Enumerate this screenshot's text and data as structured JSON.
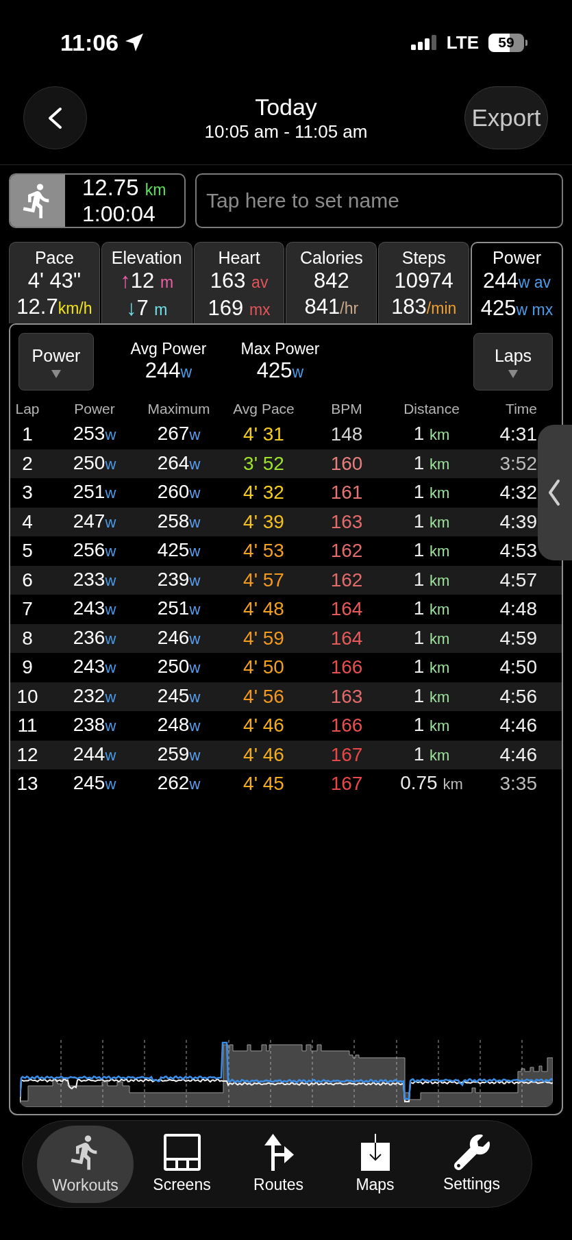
{
  "status_bar": {
    "time": "11:06",
    "network": "LTE",
    "battery": "59"
  },
  "header": {
    "title": "Today",
    "subtitle": "10:05 am - 11:05 am",
    "export_button": "Export"
  },
  "workout": {
    "distance": "12.75",
    "distance_unit": "km",
    "duration": "1:00:04"
  },
  "name_field": {
    "placeholder": "Tap here to set name"
  },
  "metric_tabs": [
    {
      "label": "Pace",
      "selected": false,
      "lines": [
        {
          "value": "4' 43\""
        },
        {
          "value": "12.7",
          "unit": "km/h",
          "color": "#f2e21a",
          "spaced": false
        }
      ]
    },
    {
      "label": "Elevation",
      "selected": false,
      "lines": [
        {
          "prefix": "↑",
          "value": "12",
          "unit": "m",
          "color": "#ec5fa8",
          "spaced": true
        },
        {
          "prefix": "↓",
          "value": "7",
          "unit": "m",
          "color": "#6fe0e8",
          "spaced": true
        }
      ]
    },
    {
      "label": "Heart",
      "selected": false,
      "lines": [
        {
          "value": "163",
          "unit": "av",
          "color": "#e0545a",
          "spaced": true
        },
        {
          "value": "169",
          "unit": "mx",
          "color": "#e0545a",
          "spaced": true
        }
      ]
    },
    {
      "label": "Calories",
      "selected": false,
      "lines": [
        {
          "value": "842"
        },
        {
          "value": "841",
          "unit": "/hr",
          "color": "#c9a88c",
          "spaced": false
        }
      ]
    },
    {
      "label": "Steps",
      "selected": false,
      "lines": [
        {
          "value": "10974"
        },
        {
          "value": "183",
          "unit": "/min",
          "color": "#f0a030",
          "spaced": false
        }
      ]
    },
    {
      "label": "Power",
      "selected": true,
      "lines": [
        {
          "value": "244",
          "unit": "w av",
          "color": "#4b9be8",
          "spaced": false
        },
        {
          "value": "425",
          "unit": "w mx",
          "color": "#4b9be8",
          "spaced": false
        }
      ]
    }
  ],
  "panel": {
    "metric_dropdown": "Power",
    "stats": [
      {
        "label": "Avg Power",
        "value": "244",
        "unit": "w"
      },
      {
        "label": "Max Power",
        "value": "425",
        "unit": "w"
      }
    ],
    "view_dropdown": "Laps"
  },
  "table": {
    "columns": [
      "Lap",
      "Power",
      "Maximum",
      "Avg Pace",
      "BPM",
      "Distance",
      "Time"
    ],
    "rows": [
      {
        "lap": "1",
        "power": {
          "value": "253",
          "unit": "w"
        },
        "maximum": {
          "value": "267",
          "unit": "w"
        },
        "avg_pace": {
          "text": "4' 31",
          "color": "#f5cc1f"
        },
        "bpm": {
          "text": "148",
          "color": "#d4d4d4"
        },
        "distance": {
          "value": "1",
          "unit": "km",
          "color": "#9ee39e"
        },
        "time": {
          "text": "4:31",
          "color": "#f0f0f0"
        }
      },
      {
        "lap": "2",
        "power": {
          "value": "250",
          "unit": "w"
        },
        "maximum": {
          "value": "264",
          "unit": "w"
        },
        "avg_pace": {
          "text": "3' 52",
          "color": "#9ee22e"
        },
        "bpm": {
          "text": "160",
          "color": "#e87f7f"
        },
        "distance": {
          "value": "1",
          "unit": "km",
          "color": "#9ee39e"
        },
        "time": {
          "text": "3:52",
          "color": "#bdbdbd"
        }
      },
      {
        "lap": "3",
        "power": {
          "value": "251",
          "unit": "w"
        },
        "maximum": {
          "value": "260",
          "unit": "w"
        },
        "avg_pace": {
          "text": "4' 32",
          "color": "#f5cc1f"
        },
        "bpm": {
          "text": "161",
          "color": "#e57474"
        },
        "distance": {
          "value": "1",
          "unit": "km",
          "color": "#9ee39e"
        },
        "time": {
          "text": "4:32",
          "color": "#f0f0f0"
        }
      },
      {
        "lap": "4",
        "power": {
          "value": "247",
          "unit": "w"
        },
        "maximum": {
          "value": "258",
          "unit": "w"
        },
        "avg_pace": {
          "text": "4' 39",
          "color": "#f5c01f"
        },
        "bpm": {
          "text": "163",
          "color": "#e36b6b"
        },
        "distance": {
          "value": "1",
          "unit": "km",
          "color": "#9ee39e"
        },
        "time": {
          "text": "4:39",
          "color": "#f0f0f0"
        }
      },
      {
        "lap": "5",
        "power": {
          "value": "256",
          "unit": "w"
        },
        "maximum": {
          "value": "425",
          "unit": "w"
        },
        "avg_pace": {
          "text": "4' 53",
          "color": "#f2a01f"
        },
        "bpm": {
          "text": "162",
          "color": "#e36b6b"
        },
        "distance": {
          "value": "1",
          "unit": "km",
          "color": "#9ee39e"
        },
        "time": {
          "text": "4:53",
          "color": "#f0f0f0"
        }
      },
      {
        "lap": "6",
        "power": {
          "value": "233",
          "unit": "w"
        },
        "maximum": {
          "value": "239",
          "unit": "w"
        },
        "avg_pace": {
          "text": "4' 57",
          "color": "#f29a1f"
        },
        "bpm": {
          "text": "162",
          "color": "#e36b6b"
        },
        "distance": {
          "value": "1",
          "unit": "km",
          "color": "#9ee39e"
        },
        "time": {
          "text": "4:57",
          "color": "#f0f0f0"
        }
      },
      {
        "lap": "7",
        "power": {
          "value": "243",
          "unit": "w"
        },
        "maximum": {
          "value": "251",
          "unit": "w"
        },
        "avg_pace": {
          "text": "4' 48",
          "color": "#f2a01f"
        },
        "bpm": {
          "text": "164",
          "color": "#e65a5a"
        },
        "distance": {
          "value": "1",
          "unit": "km",
          "color": "#9ee39e"
        },
        "time": {
          "text": "4:48",
          "color": "#f0f0f0"
        }
      },
      {
        "lap": "8",
        "power": {
          "value": "236",
          "unit": "w"
        },
        "maximum": {
          "value": "246",
          "unit": "w"
        },
        "avg_pace": {
          "text": "4' 59",
          "color": "#f29a1f"
        },
        "bpm": {
          "text": "164",
          "color": "#e65a5a"
        },
        "distance": {
          "value": "1",
          "unit": "km",
          "color": "#9ee39e"
        },
        "time": {
          "text": "4:59",
          "color": "#f0f0f0"
        }
      },
      {
        "lap": "9",
        "power": {
          "value": "243",
          "unit": "w"
        },
        "maximum": {
          "value": "250",
          "unit": "w"
        },
        "avg_pace": {
          "text": "4' 50",
          "color": "#f2a01f"
        },
        "bpm": {
          "text": "166",
          "color": "#e84f4f"
        },
        "distance": {
          "value": "1",
          "unit": "km",
          "color": "#9ee39e"
        },
        "time": {
          "text": "4:50",
          "color": "#f0f0f0"
        }
      },
      {
        "lap": "10",
        "power": {
          "value": "232",
          "unit": "w"
        },
        "maximum": {
          "value": "245",
          "unit": "w"
        },
        "avg_pace": {
          "text": "4' 56",
          "color": "#f29a1f"
        },
        "bpm": {
          "text": "163",
          "color": "#e36b6b"
        },
        "distance": {
          "value": "1",
          "unit": "km",
          "color": "#9ee39e"
        },
        "time": {
          "text": "4:56",
          "color": "#f0f0f0"
        }
      },
      {
        "lap": "11",
        "power": {
          "value": "238",
          "unit": "w"
        },
        "maximum": {
          "value": "248",
          "unit": "w"
        },
        "avg_pace": {
          "text": "4' 46",
          "color": "#f4ac1f"
        },
        "bpm": {
          "text": "166",
          "color": "#e84f4f"
        },
        "distance": {
          "value": "1",
          "unit": "km",
          "color": "#9ee39e"
        },
        "time": {
          "text": "4:46",
          "color": "#f0f0f0"
        }
      },
      {
        "lap": "12",
        "power": {
          "value": "244",
          "unit": "w"
        },
        "maximum": {
          "value": "259",
          "unit": "w"
        },
        "avg_pace": {
          "text": "4' 46",
          "color": "#f4ac1f"
        },
        "bpm": {
          "text": "167",
          "color": "#ea4848"
        },
        "distance": {
          "value": "1",
          "unit": "km",
          "color": "#9ee39e"
        },
        "time": {
          "text": "4:46",
          "color": "#f0f0f0"
        }
      },
      {
        "lap": "13",
        "power": {
          "value": "245",
          "unit": "w"
        },
        "maximum": {
          "value": "262",
          "unit": "w"
        },
        "avg_pace": {
          "text": "4' 45",
          "color": "#f4ac1f"
        },
        "bpm": {
          "text": "167",
          "color": "#ea4848"
        },
        "distance": {
          "value": "0.75",
          "unit": "km",
          "color": "#bdbdbd"
        },
        "time": {
          "text": "3:35",
          "color": "#bdbdbd"
        }
      }
    ]
  },
  "bottom_nav": [
    {
      "label": "Workouts",
      "selected": true
    },
    {
      "label": "Screens",
      "selected": false
    },
    {
      "label": "Routes",
      "selected": false
    },
    {
      "label": "Maps",
      "selected": false
    },
    {
      "label": "Settings",
      "selected": false
    }
  ]
}
